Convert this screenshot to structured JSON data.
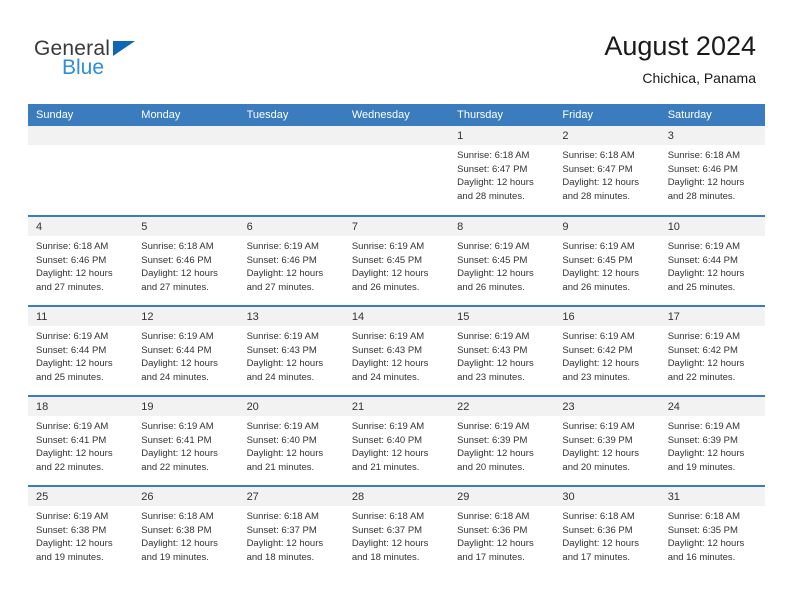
{
  "brand": {
    "name_top": "General",
    "name_bottom": "Blue",
    "triangle_color": "#0c68b5",
    "blue_text_color": "#2a8fdd"
  },
  "header": {
    "title": "August 2024",
    "subtitle": "Chichica, Panama"
  },
  "theme": {
    "header_row_bg": "#3a7cbe",
    "date_band_bg": "#f2f2f2",
    "row_divider": "#3a7cbe",
    "text": "#333333"
  },
  "columns": [
    "Sunday",
    "Monday",
    "Tuesday",
    "Wednesday",
    "Thursday",
    "Friday",
    "Saturday"
  ],
  "labels": {
    "sunrise_prefix": "Sunrise: ",
    "sunset_prefix": "Sunset: ",
    "daylight_prefix": "Daylight: "
  },
  "weeks": [
    [
      {
        "empty": true,
        "date": "",
        "sunrise": "",
        "sunset": "",
        "daylight_1": "",
        "daylight_2": ""
      },
      {
        "empty": true,
        "date": "",
        "sunrise": "",
        "sunset": "",
        "daylight_1": "",
        "daylight_2": ""
      },
      {
        "empty": true,
        "date": "",
        "sunrise": "",
        "sunset": "",
        "daylight_1": "",
        "daylight_2": ""
      },
      {
        "empty": true,
        "date": "",
        "sunrise": "",
        "sunset": "",
        "daylight_1": "",
        "daylight_2": ""
      },
      {
        "empty": false,
        "date": "1",
        "sunrise": "Sunrise: 6:18 AM",
        "sunset": "Sunset: 6:47 PM",
        "daylight_1": "Daylight: 12 hours",
        "daylight_2": "and 28 minutes."
      },
      {
        "empty": false,
        "date": "2",
        "sunrise": "Sunrise: 6:18 AM",
        "sunset": "Sunset: 6:47 PM",
        "daylight_1": "Daylight: 12 hours",
        "daylight_2": "and 28 minutes."
      },
      {
        "empty": false,
        "date": "3",
        "sunrise": "Sunrise: 6:18 AM",
        "sunset": "Sunset: 6:46 PM",
        "daylight_1": "Daylight: 12 hours",
        "daylight_2": "and 28 minutes."
      }
    ],
    [
      {
        "empty": false,
        "date": "4",
        "sunrise": "Sunrise: 6:18 AM",
        "sunset": "Sunset: 6:46 PM",
        "daylight_1": "Daylight: 12 hours",
        "daylight_2": "and 27 minutes."
      },
      {
        "empty": false,
        "date": "5",
        "sunrise": "Sunrise: 6:18 AM",
        "sunset": "Sunset: 6:46 PM",
        "daylight_1": "Daylight: 12 hours",
        "daylight_2": "and 27 minutes."
      },
      {
        "empty": false,
        "date": "6",
        "sunrise": "Sunrise: 6:19 AM",
        "sunset": "Sunset: 6:46 PM",
        "daylight_1": "Daylight: 12 hours",
        "daylight_2": "and 27 minutes."
      },
      {
        "empty": false,
        "date": "7",
        "sunrise": "Sunrise: 6:19 AM",
        "sunset": "Sunset: 6:45 PM",
        "daylight_1": "Daylight: 12 hours",
        "daylight_2": "and 26 minutes."
      },
      {
        "empty": false,
        "date": "8",
        "sunrise": "Sunrise: 6:19 AM",
        "sunset": "Sunset: 6:45 PM",
        "daylight_1": "Daylight: 12 hours",
        "daylight_2": "and 26 minutes."
      },
      {
        "empty": false,
        "date": "9",
        "sunrise": "Sunrise: 6:19 AM",
        "sunset": "Sunset: 6:45 PM",
        "daylight_1": "Daylight: 12 hours",
        "daylight_2": "and 26 minutes."
      },
      {
        "empty": false,
        "date": "10",
        "sunrise": "Sunrise: 6:19 AM",
        "sunset": "Sunset: 6:44 PM",
        "daylight_1": "Daylight: 12 hours",
        "daylight_2": "and 25 minutes."
      }
    ],
    [
      {
        "empty": false,
        "date": "11",
        "sunrise": "Sunrise: 6:19 AM",
        "sunset": "Sunset: 6:44 PM",
        "daylight_1": "Daylight: 12 hours",
        "daylight_2": "and 25 minutes."
      },
      {
        "empty": false,
        "date": "12",
        "sunrise": "Sunrise: 6:19 AM",
        "sunset": "Sunset: 6:44 PM",
        "daylight_1": "Daylight: 12 hours",
        "daylight_2": "and 24 minutes."
      },
      {
        "empty": false,
        "date": "13",
        "sunrise": "Sunrise: 6:19 AM",
        "sunset": "Sunset: 6:43 PM",
        "daylight_1": "Daylight: 12 hours",
        "daylight_2": "and 24 minutes."
      },
      {
        "empty": false,
        "date": "14",
        "sunrise": "Sunrise: 6:19 AM",
        "sunset": "Sunset: 6:43 PM",
        "daylight_1": "Daylight: 12 hours",
        "daylight_2": "and 24 minutes."
      },
      {
        "empty": false,
        "date": "15",
        "sunrise": "Sunrise: 6:19 AM",
        "sunset": "Sunset: 6:43 PM",
        "daylight_1": "Daylight: 12 hours",
        "daylight_2": "and 23 minutes."
      },
      {
        "empty": false,
        "date": "16",
        "sunrise": "Sunrise: 6:19 AM",
        "sunset": "Sunset: 6:42 PM",
        "daylight_1": "Daylight: 12 hours",
        "daylight_2": "and 23 minutes."
      },
      {
        "empty": false,
        "date": "17",
        "sunrise": "Sunrise: 6:19 AM",
        "sunset": "Sunset: 6:42 PM",
        "daylight_1": "Daylight: 12 hours",
        "daylight_2": "and 22 minutes."
      }
    ],
    [
      {
        "empty": false,
        "date": "18",
        "sunrise": "Sunrise: 6:19 AM",
        "sunset": "Sunset: 6:41 PM",
        "daylight_1": "Daylight: 12 hours",
        "daylight_2": "and 22 minutes."
      },
      {
        "empty": false,
        "date": "19",
        "sunrise": "Sunrise: 6:19 AM",
        "sunset": "Sunset: 6:41 PM",
        "daylight_1": "Daylight: 12 hours",
        "daylight_2": "and 22 minutes."
      },
      {
        "empty": false,
        "date": "20",
        "sunrise": "Sunrise: 6:19 AM",
        "sunset": "Sunset: 6:40 PM",
        "daylight_1": "Daylight: 12 hours",
        "daylight_2": "and 21 minutes."
      },
      {
        "empty": false,
        "date": "21",
        "sunrise": "Sunrise: 6:19 AM",
        "sunset": "Sunset: 6:40 PM",
        "daylight_1": "Daylight: 12 hours",
        "daylight_2": "and 21 minutes."
      },
      {
        "empty": false,
        "date": "22",
        "sunrise": "Sunrise: 6:19 AM",
        "sunset": "Sunset: 6:39 PM",
        "daylight_1": "Daylight: 12 hours",
        "daylight_2": "and 20 minutes."
      },
      {
        "empty": false,
        "date": "23",
        "sunrise": "Sunrise: 6:19 AM",
        "sunset": "Sunset: 6:39 PM",
        "daylight_1": "Daylight: 12 hours",
        "daylight_2": "and 20 minutes."
      },
      {
        "empty": false,
        "date": "24",
        "sunrise": "Sunrise: 6:19 AM",
        "sunset": "Sunset: 6:39 PM",
        "daylight_1": "Daylight: 12 hours",
        "daylight_2": "and 19 minutes."
      }
    ],
    [
      {
        "empty": false,
        "date": "25",
        "sunrise": "Sunrise: 6:19 AM",
        "sunset": "Sunset: 6:38 PM",
        "daylight_1": "Daylight: 12 hours",
        "daylight_2": "and 19 minutes."
      },
      {
        "empty": false,
        "date": "26",
        "sunrise": "Sunrise: 6:18 AM",
        "sunset": "Sunset: 6:38 PM",
        "daylight_1": "Daylight: 12 hours",
        "daylight_2": "and 19 minutes."
      },
      {
        "empty": false,
        "date": "27",
        "sunrise": "Sunrise: 6:18 AM",
        "sunset": "Sunset: 6:37 PM",
        "daylight_1": "Daylight: 12 hours",
        "daylight_2": "and 18 minutes."
      },
      {
        "empty": false,
        "date": "28",
        "sunrise": "Sunrise: 6:18 AM",
        "sunset": "Sunset: 6:37 PM",
        "daylight_1": "Daylight: 12 hours",
        "daylight_2": "and 18 minutes."
      },
      {
        "empty": false,
        "date": "29",
        "sunrise": "Sunrise: 6:18 AM",
        "sunset": "Sunset: 6:36 PM",
        "daylight_1": "Daylight: 12 hours",
        "daylight_2": "and 17 minutes."
      },
      {
        "empty": false,
        "date": "30",
        "sunrise": "Sunrise: 6:18 AM",
        "sunset": "Sunset: 6:36 PM",
        "daylight_1": "Daylight: 12 hours",
        "daylight_2": "and 17 minutes."
      },
      {
        "empty": false,
        "date": "31",
        "sunrise": "Sunrise: 6:18 AM",
        "sunset": "Sunset: 6:35 PM",
        "daylight_1": "Daylight: 12 hours",
        "daylight_2": "and 16 minutes."
      }
    ]
  ]
}
